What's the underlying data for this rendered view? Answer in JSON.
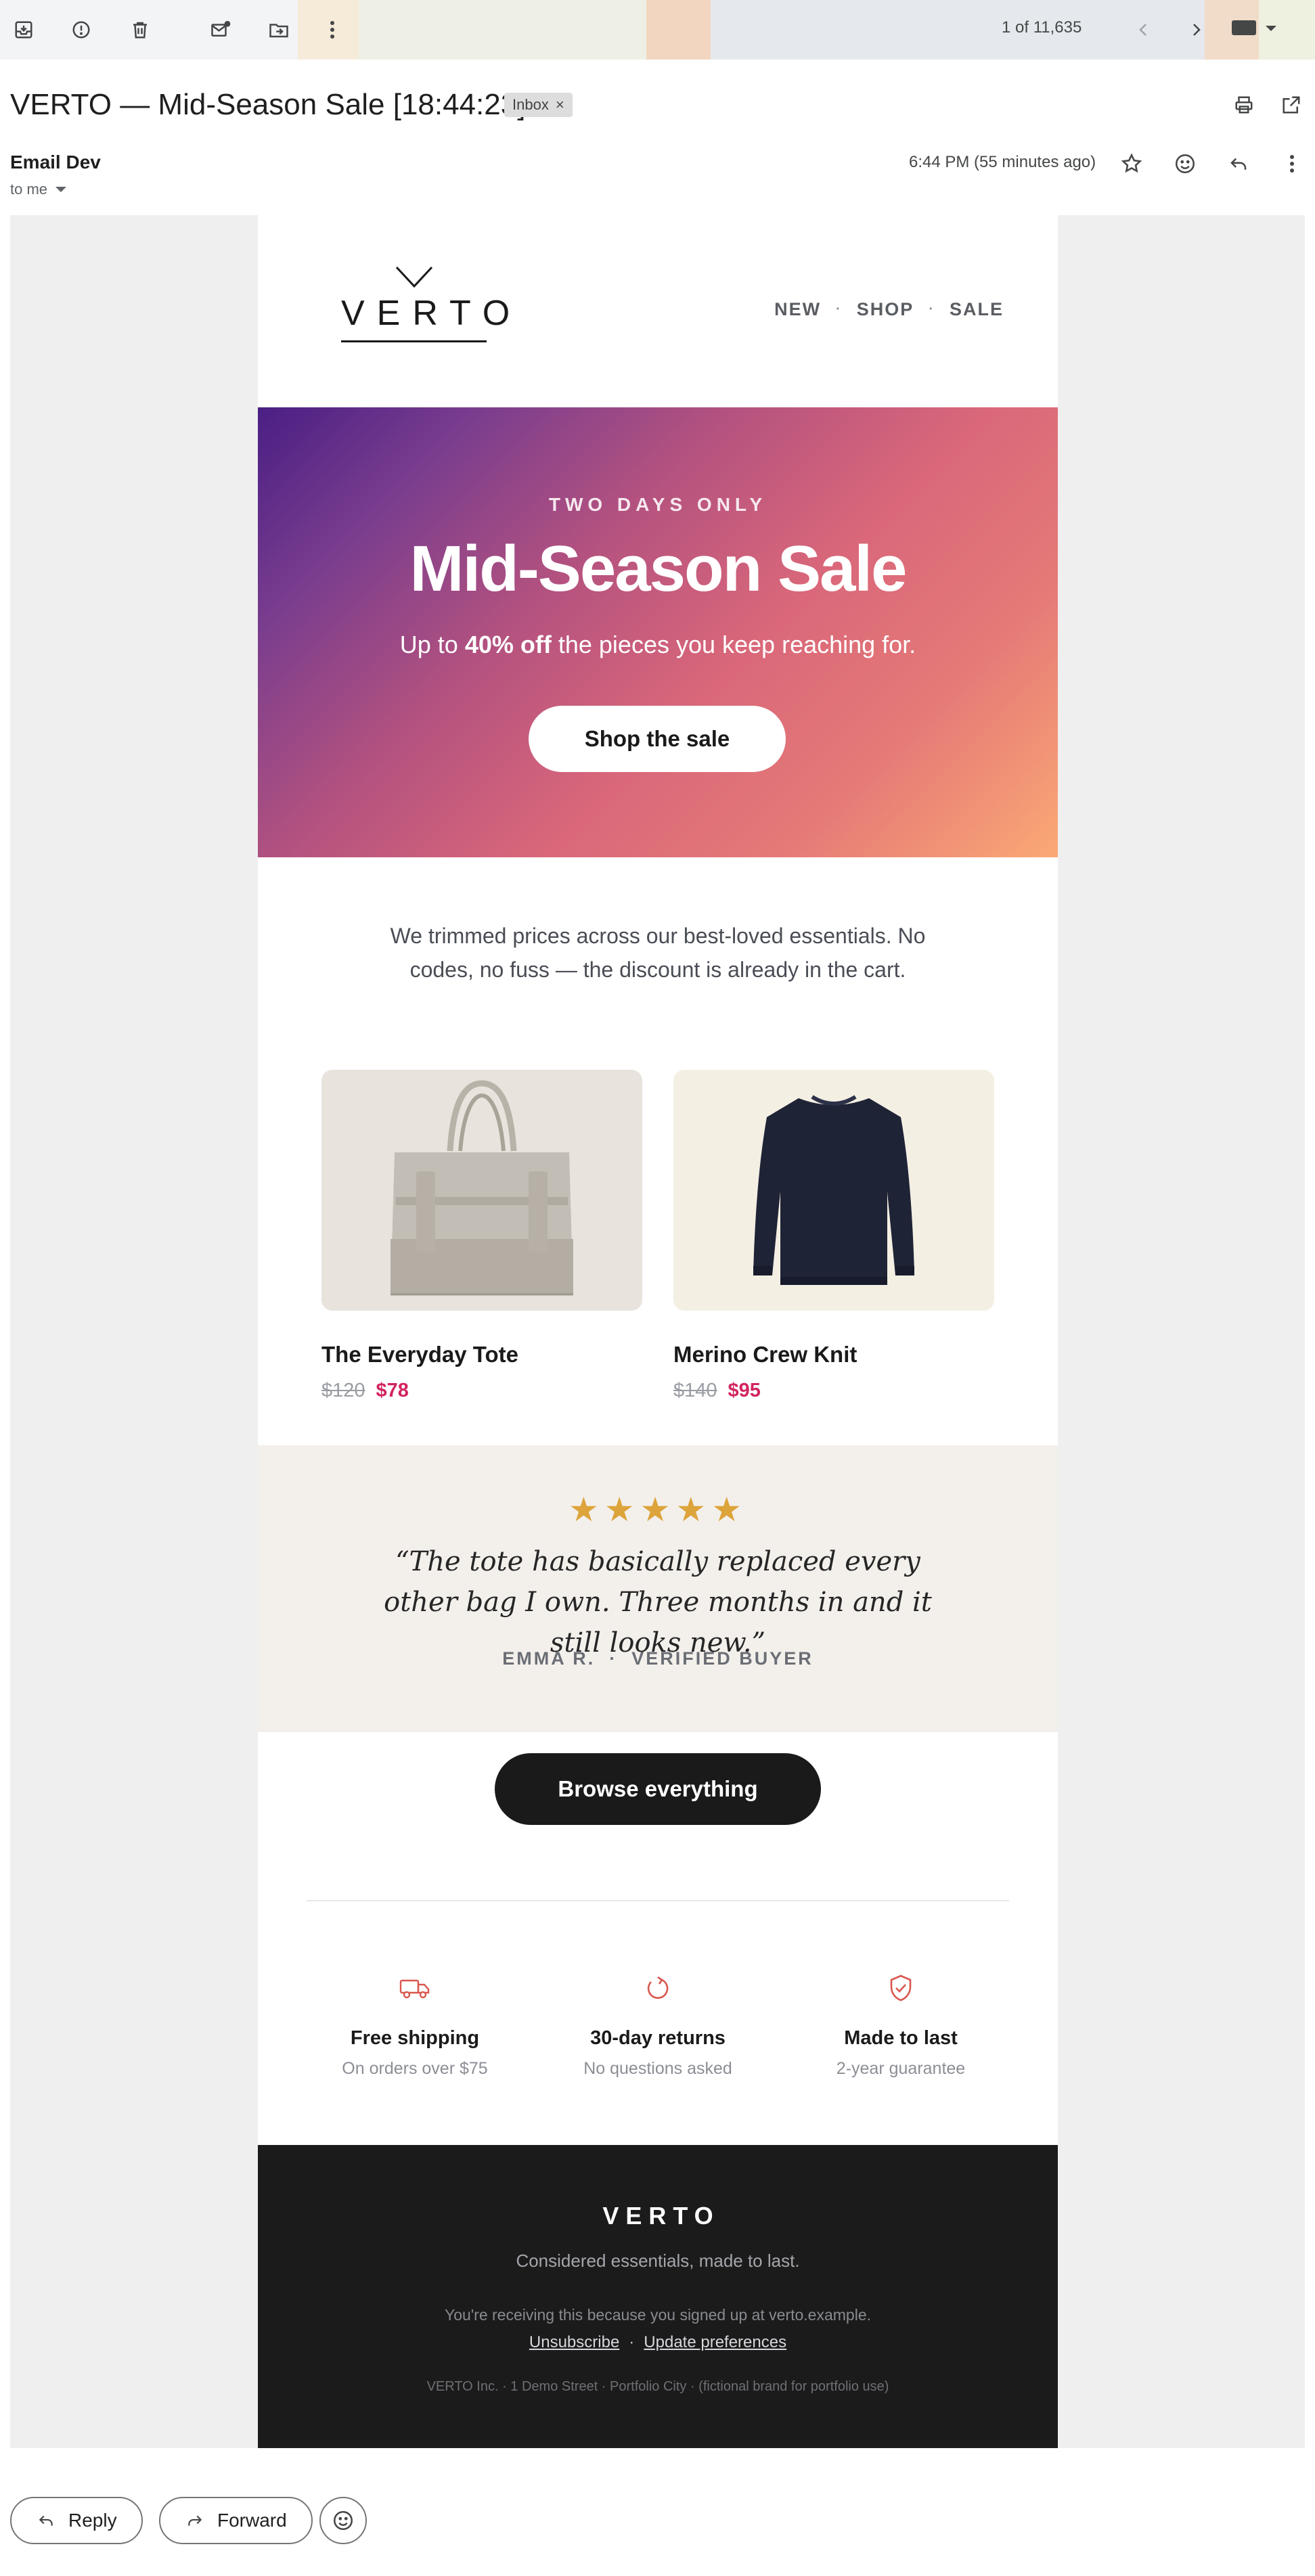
{
  "toolbar": {
    "count": "1 of 11,635",
    "icons": [
      "archive-icon",
      "report-spam-icon",
      "delete-icon",
      "mark-unread-icon",
      "move-to-icon",
      "more-vert-icon",
      "older-chevron-icon",
      "newer-chevron-icon",
      "keyboard-icon"
    ]
  },
  "email": {
    "subject": "VERTO — Mid-Season Sale [18:44:23]",
    "label": "Inbox",
    "sender": "Email Dev",
    "to": "to me",
    "time": "6:44 PM (55 minutes ago)"
  },
  "newsletter": {
    "brand": "VERTO",
    "nav": [
      "NEW",
      "SHOP",
      "SALE"
    ],
    "nav_separator": "·",
    "hero": {
      "kicker": "TWO DAYS ONLY",
      "title": "Mid-Season Sale",
      "sub_before": "Up to ",
      "sub_bold": "40% off",
      "sub_after": " the pieces you keep reaching for.",
      "cta": "Shop the sale"
    },
    "intro": "We trimmed prices across our best-loved essentials. No codes, no fuss — the discount is already in the cart.",
    "products": [
      {
        "name": "The Everyday Tote",
        "old_price": "$120",
        "new_price": "$78",
        "image_bg": "#e8e4dd"
      },
      {
        "name": "Merino Crew Knit",
        "old_price": "$140",
        "new_price": "$95",
        "image_bg": "#f3efe3"
      }
    ],
    "review": {
      "stars": "★★★★★",
      "rating": 5,
      "quote": "“The tote has basically replaced every other bag I own. Three months in and it still looks new.”",
      "reviewer": "EMMA R.",
      "separator": "·",
      "badge": "VERIFIED BUYER"
    },
    "browse_cta": "Browse everything",
    "perks": [
      {
        "icon": "truck-icon",
        "title": "Free shipping",
        "sub": "On orders over $75"
      },
      {
        "icon": "returns-icon",
        "title": "30-day returns",
        "sub": "No questions asked"
      },
      {
        "icon": "shield-check-icon",
        "title": "Made to last",
        "sub": "2-year guarantee"
      }
    ],
    "footer": {
      "brand": "VERTO",
      "tagline": "Considered essentials, made to last.",
      "reason": "You're receiving this because you signed up at verto.example.",
      "unsubscribe": "Unsubscribe",
      "link_separator": "·",
      "preferences": "Update preferences",
      "address": "VERTO Inc. · 1 Demo Street · Portfolio City · (fictional brand for portfolio use)"
    }
  },
  "actions": {
    "reply": "Reply",
    "forward": "Forward"
  },
  "colors": {
    "sale_price": "#d2245f",
    "stars": "#dda43c",
    "perk_icon": "#d9574e",
    "footer_bg": "#1b1b1b"
  }
}
